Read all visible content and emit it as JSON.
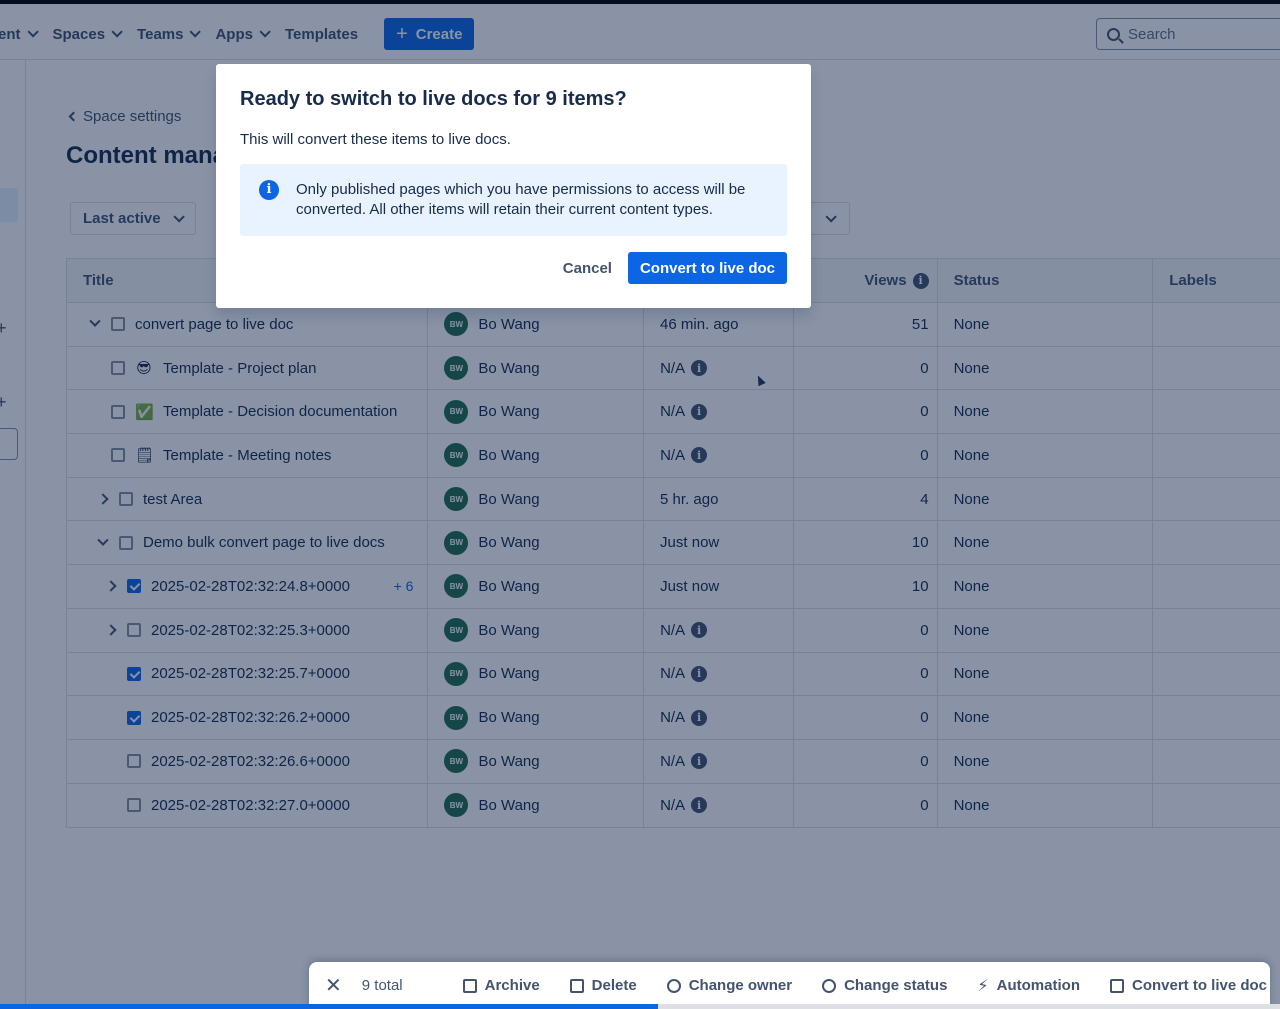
{
  "topnav": {
    "items": [
      "ent",
      "Spaces",
      "Teams",
      "Apps"
    ],
    "templates": "Templates",
    "create": "Create",
    "search_placeholder": "Search"
  },
  "page": {
    "back": "Space settings",
    "title": "Content mana",
    "filter": "Last active"
  },
  "table": {
    "headers": {
      "title": "Title",
      "views": "Views",
      "status": "Status",
      "labels": "Labels"
    },
    "rows": [
      {
        "title": "convert page to live doc",
        "indent": 0,
        "expand": "down",
        "checked": false,
        "emoji": "",
        "owner": "Bo Wang",
        "initials": "BW",
        "time": "46 min. ago",
        "info": false,
        "views": "51",
        "status": "None",
        "extra": ""
      },
      {
        "title": "Template - Project plan",
        "indent": 1,
        "expand": "",
        "checked": false,
        "emoji": "😎",
        "owner": "Bo Wang",
        "initials": "BW",
        "time": "N/A",
        "info": true,
        "views": "0",
        "status": "None",
        "extra": ""
      },
      {
        "title": "Template - Decision documentation",
        "indent": 1,
        "expand": "",
        "checked": false,
        "emoji": "✅",
        "owner": "Bo Wang",
        "initials": "BW",
        "time": "N/A",
        "info": true,
        "views": "0",
        "status": "None",
        "extra": ""
      },
      {
        "title": "Template - Meeting notes",
        "indent": 1,
        "expand": "",
        "checked": false,
        "emoji": "🗒",
        "owner": "Bo Wang",
        "initials": "BW",
        "time": "N/A",
        "info": true,
        "views": "0",
        "status": "None",
        "extra": ""
      },
      {
        "title": "test Area",
        "indent": 1,
        "expand": "right",
        "checked": false,
        "emoji": "",
        "owner": "Bo Wang",
        "initials": "BW",
        "time": "5 hr. ago",
        "info": false,
        "views": "4",
        "status": "None",
        "extra": ""
      },
      {
        "title": "Demo bulk convert page to live docs",
        "indent": 1,
        "expand": "down",
        "checked": false,
        "emoji": "",
        "owner": "Bo Wang",
        "initials": "BW",
        "time": "Just now",
        "info": false,
        "views": "10",
        "status": "None",
        "extra": ""
      },
      {
        "title": "2025-02-28T02:32:24.8+0000",
        "indent": 2,
        "expand": "right",
        "checked": true,
        "emoji": "",
        "owner": "Bo Wang",
        "initials": "BW",
        "time": "Just now",
        "info": false,
        "views": "10",
        "status": "None",
        "extra": "+ 6"
      },
      {
        "title": "2025-02-28T02:32:25.3+0000",
        "indent": 2,
        "expand": "right",
        "checked": false,
        "emoji": "",
        "owner": "Bo Wang",
        "initials": "BW",
        "time": "N/A",
        "info": true,
        "views": "0",
        "status": "None",
        "extra": ""
      },
      {
        "title": "2025-02-28T02:32:25.7+0000",
        "indent": 2,
        "expand": "",
        "checked": true,
        "emoji": "",
        "owner": "Bo Wang",
        "initials": "BW",
        "time": "N/A",
        "info": true,
        "views": "0",
        "status": "None",
        "extra": ""
      },
      {
        "title": "2025-02-28T02:32:26.2+0000",
        "indent": 2,
        "expand": "",
        "checked": true,
        "emoji": "",
        "owner": "Bo Wang",
        "initials": "BW",
        "time": "N/A",
        "info": true,
        "views": "0",
        "status": "None",
        "extra": ""
      },
      {
        "title": "2025-02-28T02:32:26.6+0000",
        "indent": 2,
        "expand": "",
        "checked": false,
        "emoji": "",
        "owner": "Bo Wang",
        "initials": "BW",
        "time": "N/A",
        "info": true,
        "views": "0",
        "status": "None",
        "extra": ""
      },
      {
        "title": "2025-02-28T02:32:27.0+0000",
        "indent": 2,
        "expand": "",
        "checked": false,
        "emoji": "",
        "owner": "Bo Wang",
        "initials": "BW",
        "time": "N/A",
        "info": true,
        "views": "0",
        "status": "None",
        "extra": ""
      }
    ]
  },
  "modal": {
    "title": "Ready to switch to live docs for 9 items?",
    "body": "This will convert these items to live docs.",
    "notice": "Only published pages which you have permissions to access will be converted. All other items will retain their current content types.",
    "cancel": "Cancel",
    "confirm": "Convert to live doc"
  },
  "actionbar": {
    "total": "9 total",
    "archive": "Archive",
    "delete": "Delete",
    "change_owner": "Change owner",
    "change_status": "Change status",
    "automation": "Automation",
    "convert": "Convert to live doc"
  },
  "colors": {
    "primary": "#0c66e4",
    "avatar": "#216e4e",
    "overlay": "rgba(9,30,66,0.48)"
  }
}
